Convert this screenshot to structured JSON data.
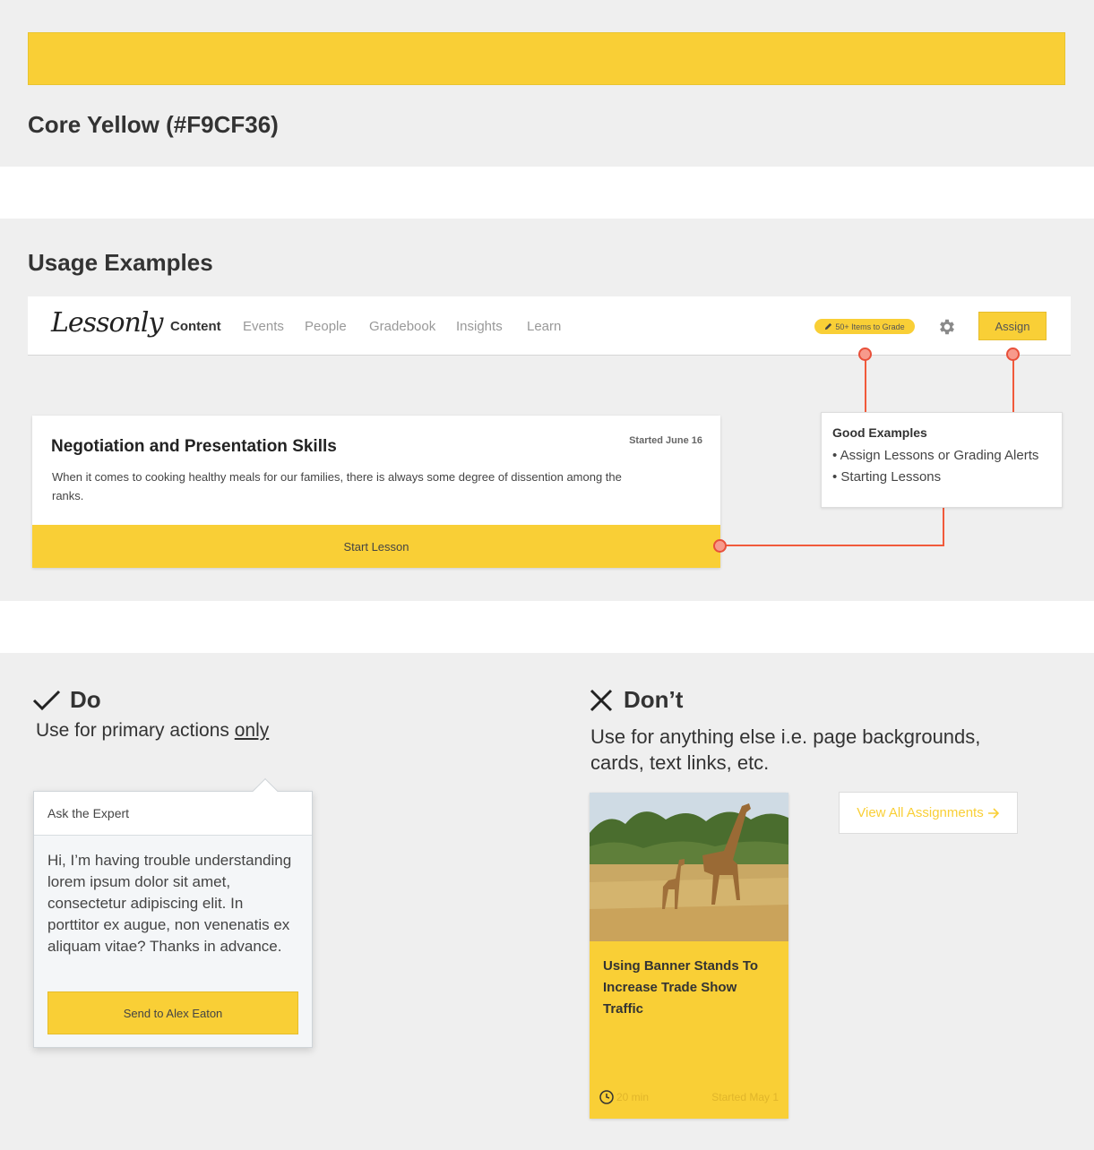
{
  "swatch": {
    "title": "Core Yellow (#F9CF36)",
    "color": "#F9CF36"
  },
  "usage": {
    "title": "Usage Examples",
    "nav": {
      "logo": "Lessonly",
      "items": [
        "Content",
        "Events",
        "People",
        "Gradebook",
        "Insights",
        "Learn"
      ],
      "active": "Content",
      "grade_badge": "50+ Items to Grade",
      "assign_label": "Assign"
    },
    "lesson": {
      "title": "Negotiation and Presentation Skills",
      "started": "Started June 16",
      "description": "When it comes to cooking healthy meals for our families, there is always some degree of dissention among the ranks.",
      "button": "Start Lesson"
    },
    "good_examples": {
      "title": "Good Examples",
      "items": [
        "• Assign Lessons or Grading Alerts",
        "• Starting Lessons"
      ]
    }
  },
  "do": {
    "label": "Do",
    "desc_prefix": "Use for primary actions ",
    "desc_emphasis": "only",
    "expert": {
      "header": "Ask the Expert",
      "body": "Hi, I’m having trouble understanding lorem ipsum dolor sit amet, consectetur adipiscing elit. In porttitor ex augue, non venenatis ex aliquam vitae? Thanks in advance.",
      "button": "Send to Alex Eaton"
    }
  },
  "dont": {
    "label": "Don’t",
    "desc": "Use for anything else i.e. page backgrounds, cards, text links, etc.",
    "card": {
      "title": "Using Banner Stands To Increase Trade Show Traffic",
      "duration": "20 min",
      "started": "Started May 1"
    },
    "link_button": "View All Assignments"
  },
  "colors": {
    "core_yellow": "#F9CF36",
    "connector": "#f15a3b"
  },
  "icons": {
    "pencil": "pencil-icon",
    "gear": "gear-icon",
    "check": "check-icon",
    "cross": "x-icon",
    "clock": "clock-icon",
    "arrow": "arrow-right-icon"
  }
}
